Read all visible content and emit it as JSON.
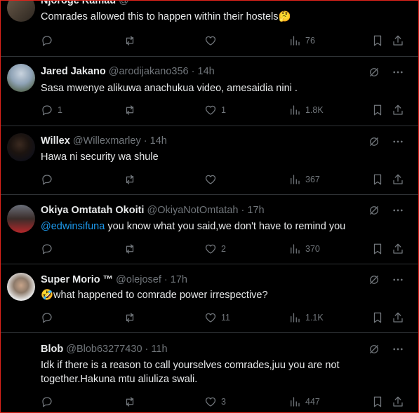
{
  "tweets": [
    {
      "name": "Njoroge Kamau",
      "handle": "@",
      "time": "",
      "dot": "·",
      "text": "Comrades allowed this to happen within their hostels🤔",
      "replies": "",
      "retweets": "",
      "likes": "",
      "views": "76",
      "mention": ""
    },
    {
      "name": "Jared Jakano",
      "handle": "@arodijakano356",
      "time": "14h",
      "dot": "·",
      "text": "Sasa mwenye alikuwa anachukua video,  amesaidia nini .",
      "replies": "1",
      "retweets": "",
      "likes": "1",
      "views": "1.8K",
      "mention": ""
    },
    {
      "name": "Willex",
      "handle": "@Willexmarley",
      "time": "14h",
      "dot": "·",
      "text": "Hawa ni security wa shule",
      "replies": "",
      "retweets": "",
      "likes": "",
      "views": "367",
      "mention": ""
    },
    {
      "name": "Okiya Omtatah Okoiti",
      "handle": "@OkiyaNotOmtatah",
      "time": "17h",
      "dot": "·",
      "mention": "@edwinsifuna",
      "text": " you know what you said,we don't have to remind you",
      "replies": "",
      "retweets": "",
      "likes": "2",
      "views": "370"
    },
    {
      "name": "Super Morio ™",
      "handle": "@olejosef",
      "time": "17h",
      "dot": "·",
      "text": "🤣what happened to comrade power irrespective?",
      "replies": "",
      "retweets": "",
      "likes": "11",
      "views": "1.1K",
      "mention": ""
    },
    {
      "name": "Blob",
      "handle": "@Blob63277430",
      "time": "11h",
      "dot": "·",
      "text": "Idk if there is a reason to call yourselves comrades,juu  you are not together.Hakuna mtu aliuliza swali.",
      "replies": "",
      "retweets": "",
      "likes": "3",
      "views": "447",
      "mention": ""
    }
  ],
  "icons": {
    "reply": "reply-icon",
    "retweet": "retweet-icon",
    "like": "heart-icon",
    "views": "views-icon",
    "bookmark": "bookmark-icon",
    "share": "share-icon",
    "grok": "grok-icon",
    "more": "more-icon"
  },
  "colors": {
    "background": "#000000",
    "text": "#e7e9ea",
    "muted": "#71767b",
    "link": "#1d9bf0",
    "divider": "#2f3336",
    "frame": "#e0241b"
  }
}
